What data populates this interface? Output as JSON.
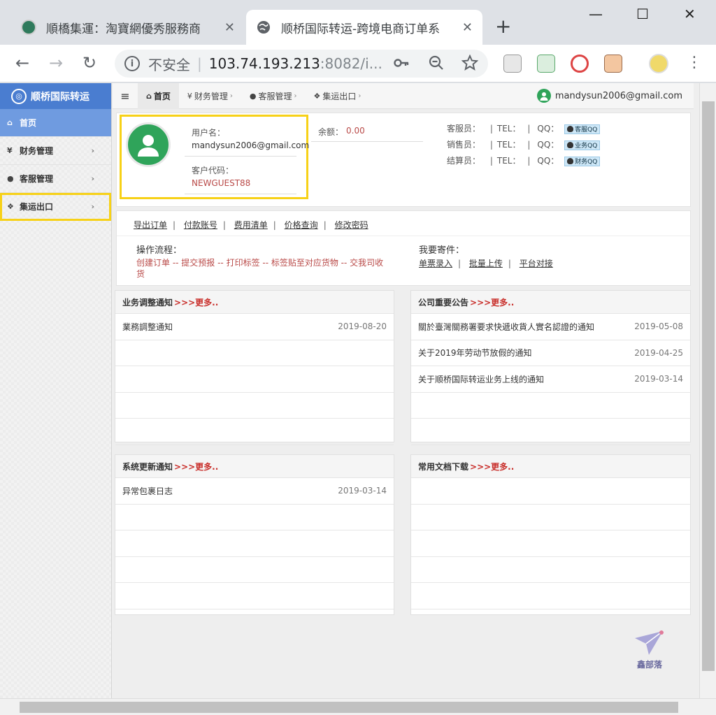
{
  "browser": {
    "tabs": [
      {
        "title": "順橋集運：淘寶網優秀服務商",
        "close": "✕"
      },
      {
        "title": "顺桥国际转运-跨境电商订单系",
        "close": "✕"
      }
    ],
    "new_tab": "+",
    "window_controls": {
      "minimize": "—",
      "maximize": "☐",
      "close": "✕"
    },
    "nav": {
      "back": "←",
      "forward": "→",
      "reload": "↻"
    },
    "address": {
      "security_label": "不安全",
      "separator": "|",
      "host": "103.74.193.213",
      "path": ":8082/i..."
    },
    "menu": "⋮"
  },
  "sidebar": {
    "brand": "顺桥国际转运",
    "items": [
      {
        "label": "首页",
        "icon": "home-icon",
        "glyph": "⌂"
      },
      {
        "label": "财务管理",
        "icon": "yen-icon",
        "glyph": "¥"
      },
      {
        "label": "客服管理",
        "icon": "user-icon",
        "glyph": "●"
      },
      {
        "label": "集运出口",
        "icon": "cubes-icon",
        "glyph": "❖"
      }
    ],
    "chevron": "›"
  },
  "topnav": {
    "menu_icon": "≡",
    "items": [
      {
        "label": "首页",
        "glyph": "⌂"
      },
      {
        "label": "财务管理",
        "glyph": "¥"
      },
      {
        "label": "客服管理",
        "glyph": "●"
      },
      {
        "label": "集运出口",
        "glyph": "❖"
      }
    ],
    "chevron": "›",
    "user_email": "mandysun2006@gmail.com"
  },
  "profile": {
    "username_label": "用户名：",
    "username": "mandysun2006@gmail.com",
    "code_label": "客户代码：",
    "code": "NEWGUEST88",
    "balance_label": "余额：",
    "balance": "0.00"
  },
  "contacts": [
    {
      "role": "客服员：",
      "tel": "TEL：",
      "qq": "QQ：",
      "qq_badge": "客服QQ"
    },
    {
      "role": "销售员：",
      "tel": "TEL：",
      "qq": "QQ：",
      "qq_badge": "业务QQ"
    },
    {
      "role": "结算员：",
      "tel": "TEL：",
      "qq": "QQ：",
      "qq_badge": "财务QQ"
    }
  ],
  "quick_links": [
    "导出订单",
    "付款账号",
    "费用清单",
    "价格查询",
    "修改密码"
  ],
  "process": {
    "label": "操作流程：",
    "steps": "创建订单 -- 提交预报 -- 打印标签 -- 标签贴至对应货物 -- 交我司收货"
  },
  "shipping": {
    "label": "我要寄件：",
    "links": [
      "单票录入",
      "批量上传",
      "平台对接"
    ]
  },
  "news": {
    "more": ">>>更多..",
    "business": {
      "title": "业务调整通知",
      "rows": [
        {
          "title": "業務調整通知",
          "date": "2019-08-20"
        }
      ]
    },
    "company": {
      "title": "公司重要公告",
      "rows": [
        {
          "title": "關於臺灣關務署要求快遞收貨人實名認證的通知",
          "date": "2019-05-08"
        },
        {
          "title": "关于2019年劳动节放假的通知",
          "date": "2019-04-25"
        },
        {
          "title": "关于顺桥国际转运业务上线的通知",
          "date": "2019-03-14"
        }
      ]
    },
    "system": {
      "title": "系统更新通知",
      "rows": [
        {
          "title": "异常包裹日志",
          "date": "2019-03-14"
        }
      ]
    },
    "docs": {
      "title": "常用文档下载",
      "rows": []
    }
  },
  "watermark": "鑫部落",
  "colors": {
    "brand_blue": "#4a7dd0",
    "active_nav": "#6f9be0",
    "highlight": "#f7d117",
    "accent_red": "#c9302c",
    "avatar_green": "#2fa45a"
  }
}
